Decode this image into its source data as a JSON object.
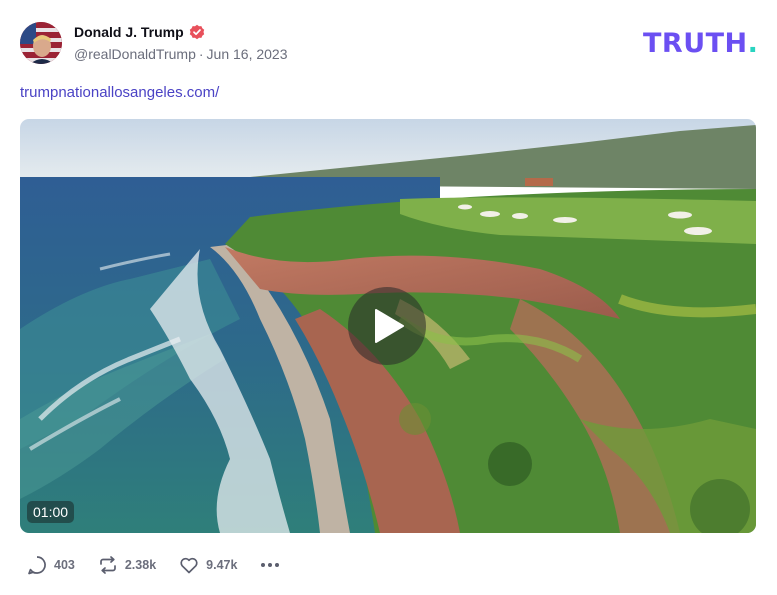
{
  "post": {
    "author": {
      "display_name": "Donald J. Trump",
      "handle": "@realDonaldTrump",
      "date": "Jun 16, 2023",
      "verified": true,
      "verified_color": "#e8505b"
    },
    "brand": {
      "text": "TRUTH",
      "dot": ".",
      "color": "#6b4ff2",
      "dot_color": "#2ad4c0"
    },
    "link_text": "trumpnationallosangeles.com/",
    "link_color": "#4b43c5",
    "video": {
      "duration": "01:00",
      "icon": "play-icon"
    },
    "actions": {
      "replies": "403",
      "retruths": "2.38k",
      "likes": "9.47k",
      "more_icon": "ellipsis-icon"
    }
  }
}
